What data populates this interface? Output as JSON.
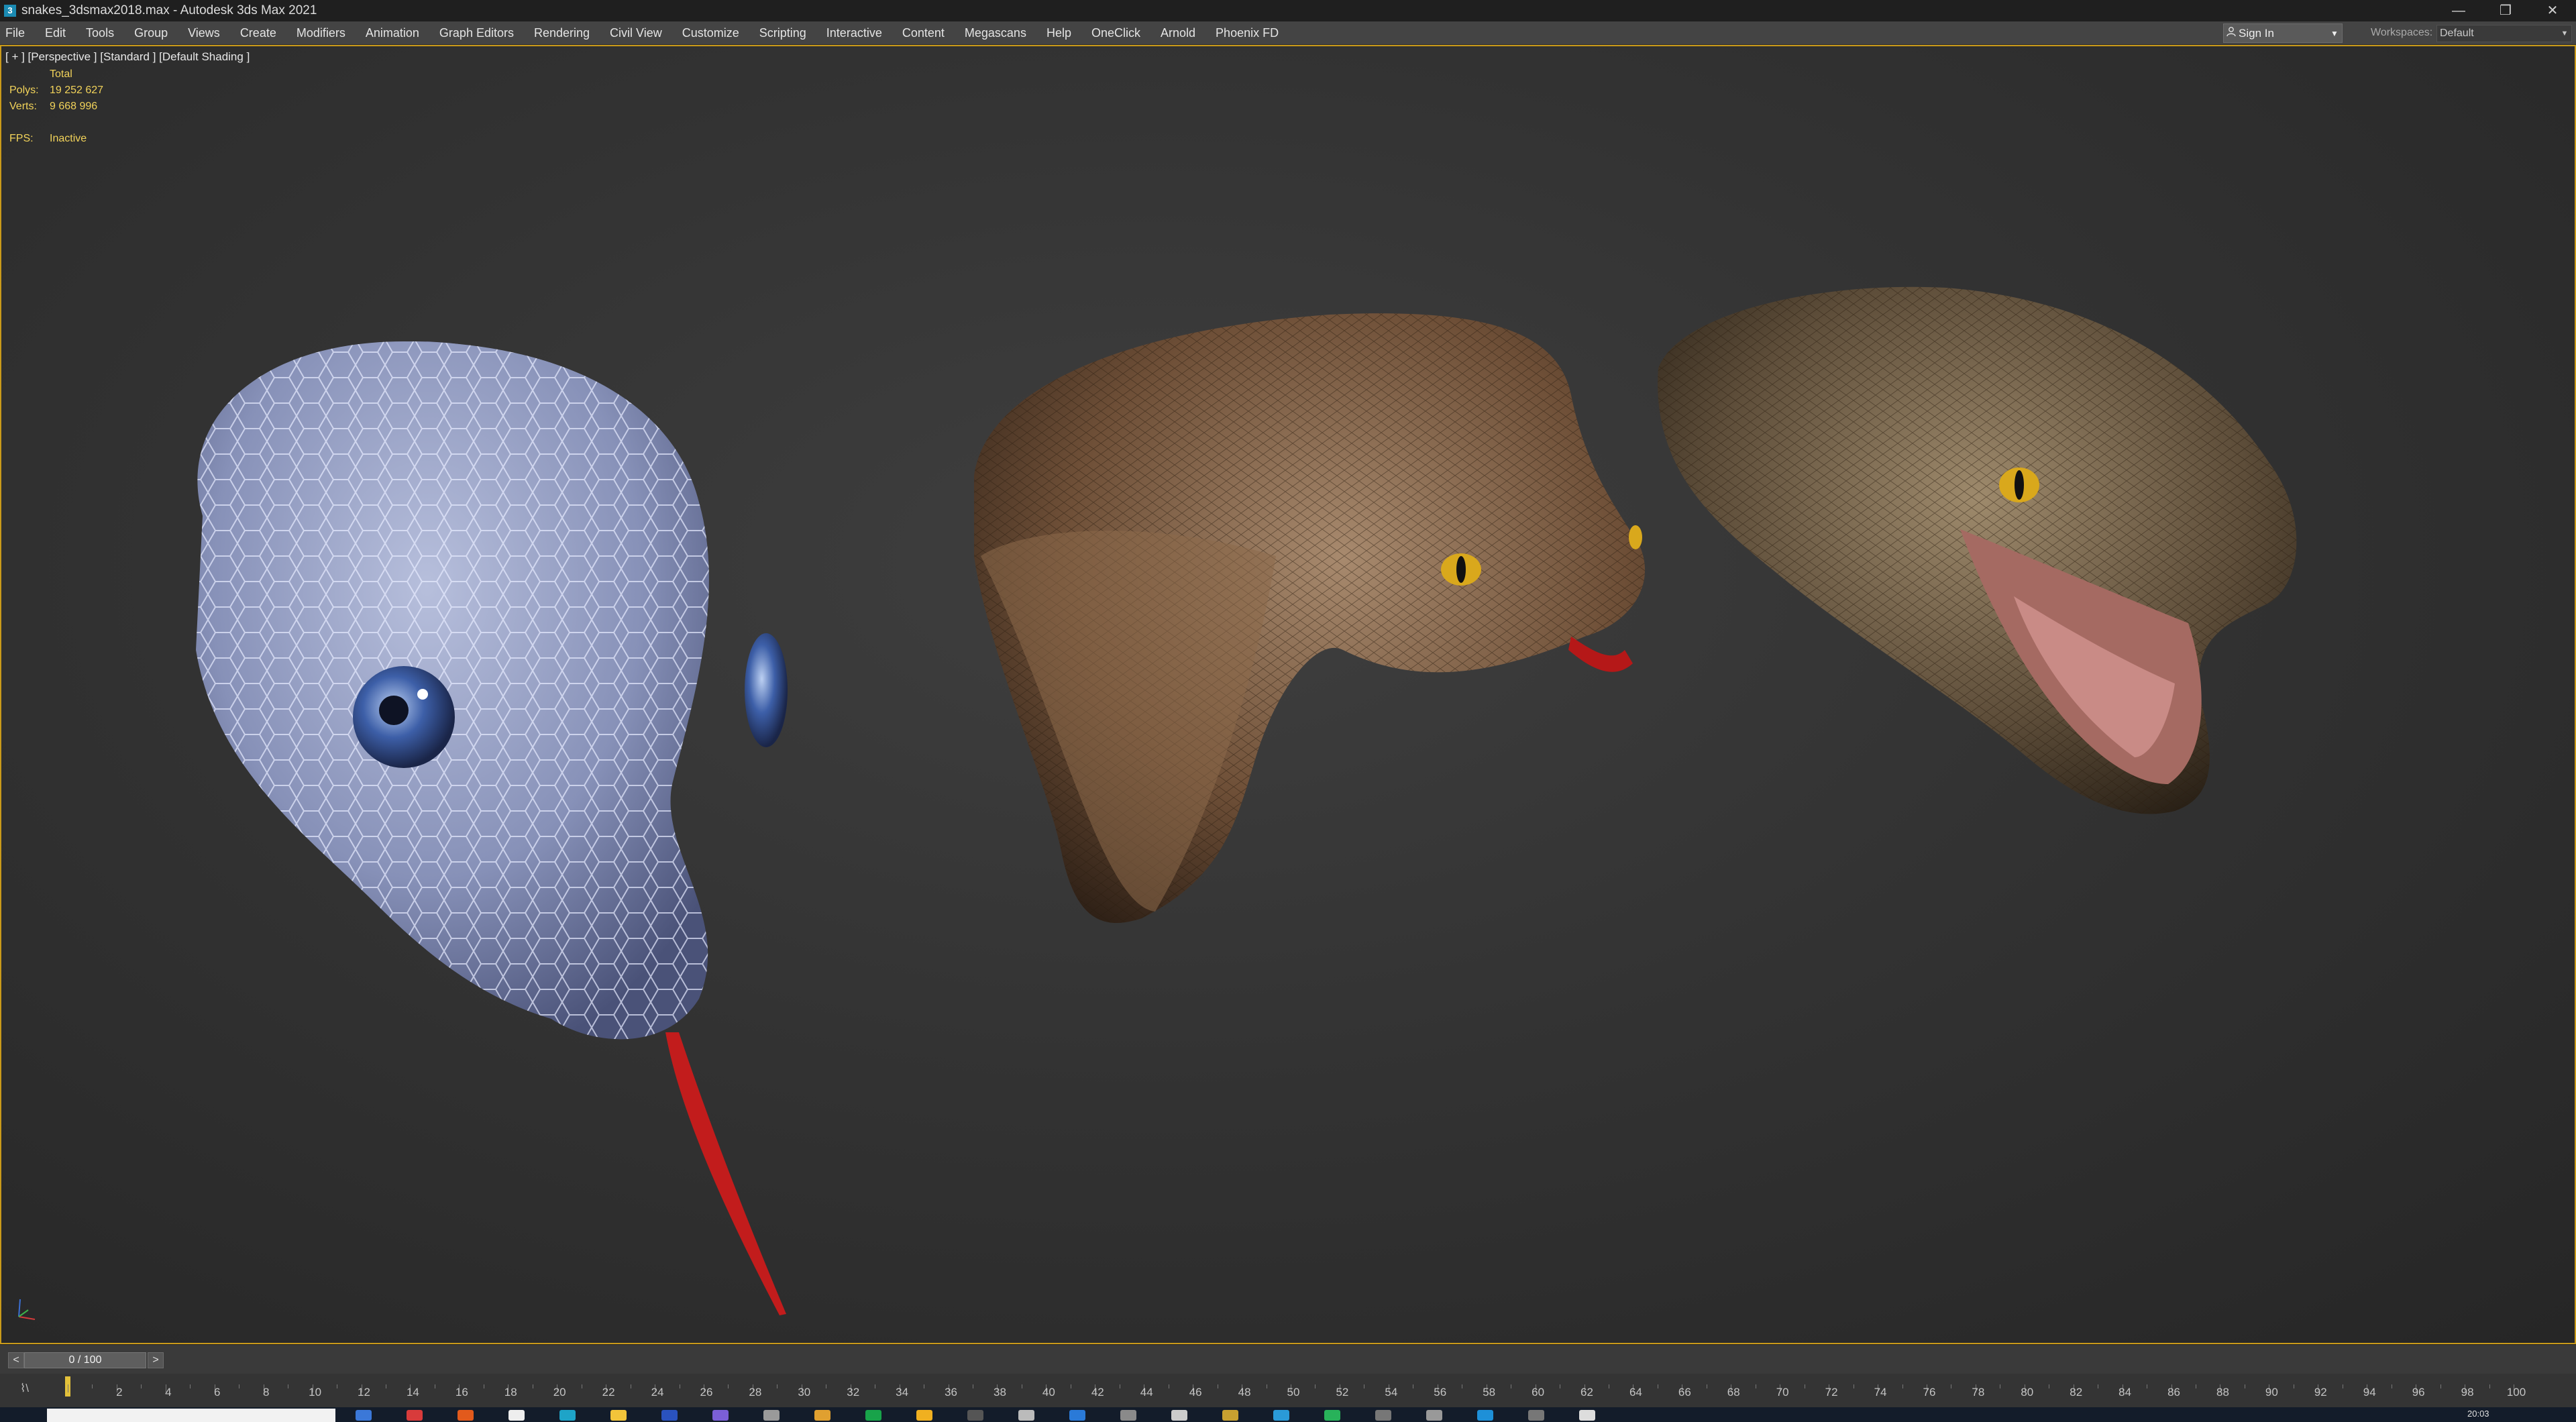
{
  "window": {
    "title": "snakes_3dsmax2018.max - Autodesk 3ds Max 2021",
    "app_icon_glyph": "3",
    "controls": {
      "minimize": "—",
      "maximize": "❐",
      "close": "✕"
    }
  },
  "menu": {
    "items": [
      "File",
      "Edit",
      "Tools",
      "Group",
      "Views",
      "Create",
      "Modifiers",
      "Animation",
      "Graph Editors",
      "Rendering",
      "Civil View",
      "Customize",
      "Scripting",
      "Interactive",
      "Content",
      "Megascans",
      "Help",
      "OneClick",
      "Arnold",
      "Phoenix FD"
    ],
    "signin": {
      "icon": "user-icon",
      "label": "Sign In",
      "arrow": "▼"
    },
    "workspaces": {
      "label": "Workspaces:",
      "value": "Default",
      "arrow": "▼"
    }
  },
  "viewport": {
    "label": "[ + ] [Perspective ] [Standard ] [Default Shading ]",
    "stats": {
      "header": "Total",
      "polys_label": "Polys:",
      "polys_value": "19 252 627",
      "verts_label": "Verts:",
      "verts_value": "9 668 996",
      "fps_label": "FPS:",
      "fps_value": "Inactive"
    },
    "border_color": "#c99a1a"
  },
  "timeline": {
    "frame_readout": "0 / 100",
    "prev_glyph": "<",
    "next_glyph": ">",
    "trackbar_icon": "⌇\\",
    "tick_labels": [
      "2",
      "4",
      "6",
      "8",
      "10",
      "12",
      "14",
      "16",
      "18",
      "20",
      "22",
      "24",
      "26",
      "28",
      "30",
      "32",
      "34",
      "36",
      "38",
      "40",
      "42",
      "44",
      "46",
      "48",
      "50",
      "52",
      "54",
      "56",
      "58",
      "60",
      "62",
      "64",
      "66",
      "68",
      "70",
      "72",
      "74",
      "76",
      "78",
      "80",
      "82",
      "84",
      "86",
      "88",
      "90",
      "92",
      "94",
      "96",
      "98",
      "100"
    ],
    "current_frame": 0,
    "total_frames": 100
  },
  "taskbar": {
    "clock": "20:03",
    "icon_colors": [
      "#3b78d8",
      "#d83b3b",
      "#e25a1c",
      "#eeeeee",
      "#1ea4c8",
      "#f2c43a",
      "#2a52be",
      "#7b5fd6",
      "#9a9a9a",
      "#e0a030",
      "#18a34a",
      "#f0b020",
      "#555555",
      "#bbbbbb",
      "#2a7ad8",
      "#8a8a8a",
      "#cccccc",
      "#c8a030",
      "#2a9ad8",
      "#28b25a",
      "#777777",
      "#999999",
      "#1e90d8",
      "#777777",
      "#dddddd"
    ]
  }
}
